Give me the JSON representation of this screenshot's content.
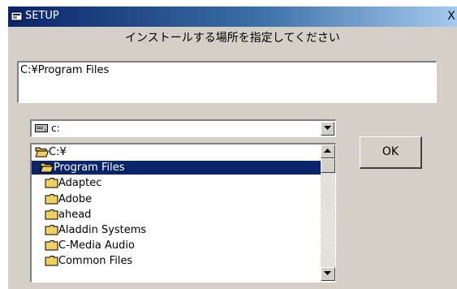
{
  "window": {
    "title": "SETUP",
    "close_label": "X"
  },
  "instruction": "インストールする場所を指定してください",
  "path_field": {
    "value": "C:¥Program Files"
  },
  "drive_select": {
    "selected": "c:",
    "icon": "drive-icon"
  },
  "folder_list": {
    "items": [
      {
        "label": "C:¥",
        "icon": "open-folder-icon",
        "selected": false
      },
      {
        "label": "Program Files",
        "icon": "open-folder-icon",
        "selected": true
      },
      {
        "label": "Adaptec",
        "icon": "folder-icon",
        "selected": false
      },
      {
        "label": "Adobe",
        "icon": "folder-icon",
        "selected": false
      },
      {
        "label": "ahead",
        "icon": "folder-icon",
        "selected": false
      },
      {
        "label": "Aladdin Systems",
        "icon": "folder-icon",
        "selected": false
      },
      {
        "label": "C-Media Audio",
        "icon": "folder-icon",
        "selected": false
      },
      {
        "label": "Common Files",
        "icon": "folder-icon",
        "selected": false
      }
    ]
  },
  "ok_button": {
    "label": "OK"
  },
  "colors": {
    "title_bar": "#0a246a",
    "selection": "#0a246a",
    "face": "#d4d0c8",
    "folder": "#f0d060"
  }
}
